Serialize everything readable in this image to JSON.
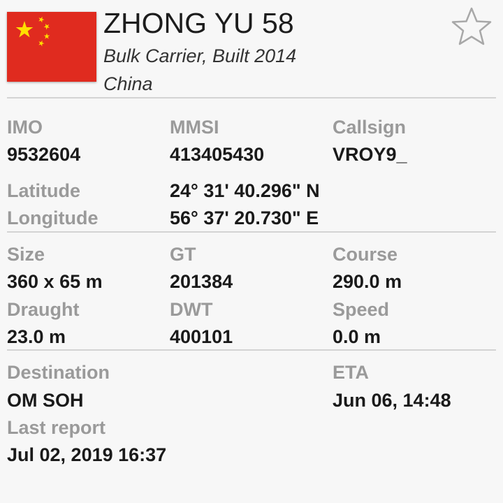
{
  "vessel": {
    "name": "ZHONG YU 58",
    "type_built": "Bulk Carrier, Built 2014",
    "country": "China",
    "flag_icon": "china-flag-icon",
    "favorite_icon": "star-outline-icon"
  },
  "identifiers": {
    "imo_label": "IMO",
    "imo": "9532604",
    "mmsi_label": "MMSI",
    "mmsi": "413405430",
    "callsign_label": "Callsign",
    "callsign": "VROY9_"
  },
  "position": {
    "latitude_label": "Latitude",
    "latitude": "24° 31' 40.296\" N",
    "longitude_label": "Longitude",
    "longitude": "56° 37' 20.730\" E"
  },
  "dimensions": {
    "size_label": "Size",
    "size": "360 x 65 m",
    "gt_label": "GT",
    "gt": "201384",
    "course_label": "Course",
    "course": "290.0 m",
    "draught_label": "Draught",
    "draught": "23.0 m",
    "dwt_label": "DWT",
    "dwt": "400101",
    "speed_label": "Speed",
    "speed": "0.0 m"
  },
  "voyage": {
    "destination_label": "Destination",
    "destination": "OM SOH",
    "eta_label": "ETA",
    "eta": "Jun 06, 14:48",
    "last_report_label": "Last report",
    "last_report": "Jul 02, 2019 16:37"
  },
  "colors": {
    "flag_red": "#e02b1f",
    "flag_star": "#ffde00",
    "label_gray": "#9a9a9a",
    "divider_gray": "#d3d3d3"
  }
}
